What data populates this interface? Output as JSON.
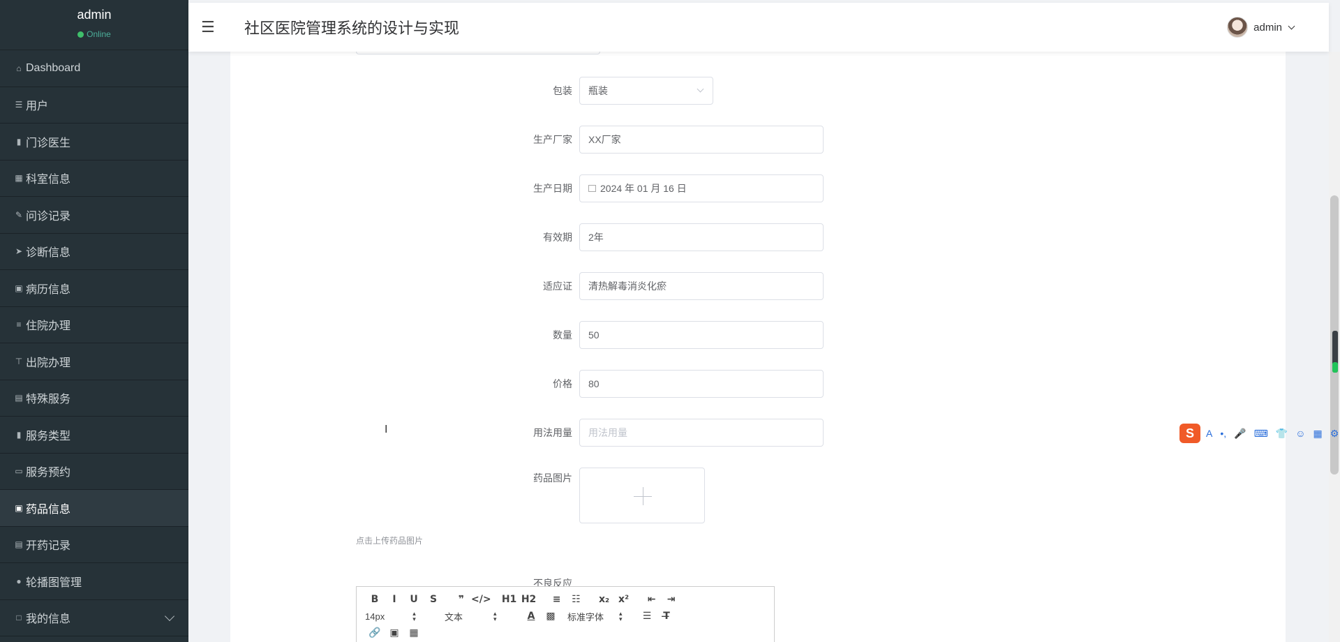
{
  "sidebar": {
    "user_name": "admin",
    "status": "Online",
    "items": [
      {
        "label": "Dashboard",
        "icon": "home-icon",
        "glyph": "⌂"
      },
      {
        "label": "用户",
        "icon": "sliders-icon",
        "glyph": "☰"
      },
      {
        "label": "门诊医生",
        "icon": "bar-chart-icon",
        "glyph": "▮"
      },
      {
        "label": "科室信息",
        "icon": "grid-icon",
        "glyph": "▦"
      },
      {
        "label": "问诊记录",
        "icon": "thumbs-up-icon",
        "glyph": "✎"
      },
      {
        "label": "诊断信息",
        "icon": "send-icon",
        "glyph": "➤"
      },
      {
        "label": "病历信息",
        "icon": "dashboard-icon",
        "glyph": "▣"
      },
      {
        "label": "住院办理",
        "icon": "list-icon",
        "glyph": "≡"
      },
      {
        "label": "出院办理",
        "icon": "pin-icon",
        "glyph": "⊤"
      },
      {
        "label": "特殊服务",
        "icon": "clipboard-icon",
        "glyph": "▤"
      },
      {
        "label": "服务类型",
        "icon": "chart-icon",
        "glyph": "▮"
      },
      {
        "label": "服务预约",
        "icon": "monitor-icon",
        "glyph": "▭"
      },
      {
        "label": "药品信息",
        "icon": "dashboard-icon",
        "glyph": "▣",
        "active": true
      },
      {
        "label": "开药记录",
        "icon": "clipboard-icon",
        "glyph": "▤"
      },
      {
        "label": "轮播图管理",
        "icon": "user-icon",
        "glyph": "●"
      },
      {
        "label": "我的信息",
        "icon": "window-icon",
        "glyph": "□",
        "expandable": true
      }
    ]
  },
  "header": {
    "title": "社区医院管理系统的设计与实现",
    "user": "admin"
  },
  "form": {
    "packaging": {
      "label": "包装",
      "value": "瓶装"
    },
    "manufacturer": {
      "label": "生产厂家",
      "value": "XX厂家"
    },
    "production_date": {
      "label": "生产日期",
      "value": "2024 年 01 月 16 日"
    },
    "validity": {
      "label": "有效期",
      "value": "2年"
    },
    "indication": {
      "label": "适应证",
      "value": "清热解毒消炎化瘀"
    },
    "quantity": {
      "label": "数量",
      "value": "50"
    },
    "price": {
      "label": "价格",
      "value": "80"
    },
    "usage": {
      "label": "用法用量",
      "placeholder": "用法用量"
    },
    "image": {
      "label": "药品图片",
      "tip": "点击上传药品图片"
    },
    "adverse": {
      "label": "不良反应"
    }
  },
  "editor": {
    "row1": [
      "B",
      "I",
      "U",
      "S",
      "❞",
      "</>",
      "H1",
      "H2",
      "≡",
      "☷",
      "x₂",
      "x²",
      "⇤",
      "⇥"
    ],
    "font_size": "14px",
    "block_type": "文本",
    "font_family": "标准字体",
    "row3": [
      "🔗",
      "▣",
      "▦"
    ]
  },
  "ime": {
    "logo": "S",
    "icons": [
      "A",
      "•,",
      "🎤",
      "⌨",
      "👕",
      "☺",
      "▦",
      "⚙"
    ]
  }
}
